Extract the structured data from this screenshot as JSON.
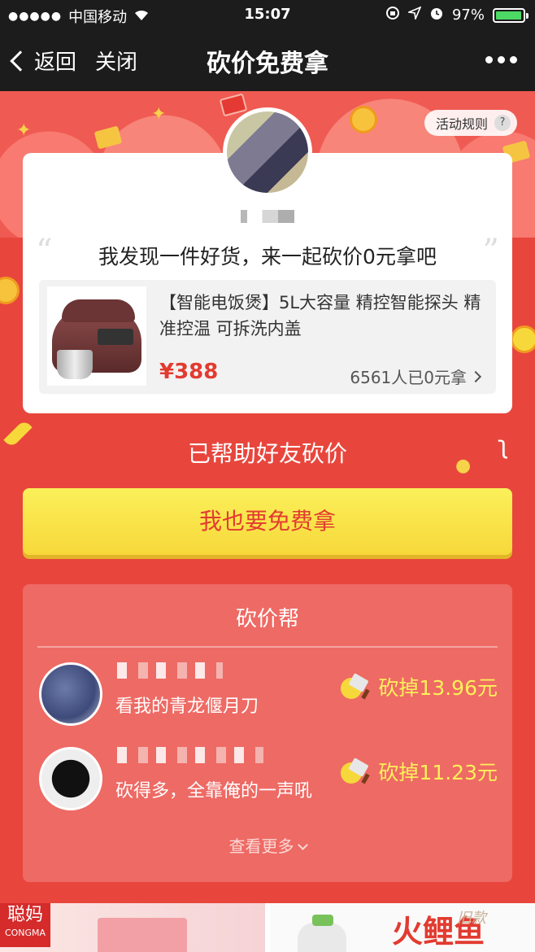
{
  "status_bar": {
    "signal": "●●●●●",
    "carrier": "中国移动",
    "time": "15:07",
    "battery_percent": "97%",
    "battery_level": 0.97
  },
  "nav": {
    "back_label": "返回",
    "close_label": "关闭",
    "title": "砍价免费拿"
  },
  "rules_button": {
    "label": "活动规则",
    "icon_glyph": "?"
  },
  "share_card": {
    "quote_open": "“",
    "quote": "我发现一件好货，来一起砍价0元拿吧",
    "quote_close": "”",
    "product": {
      "title": "【智能电饭煲】5L大容量 精控智能探头 精准控温 可拆洗内盖",
      "price": "¥388",
      "claimed": "6561人已0元拿"
    }
  },
  "helped_text": "已帮助好友砍价",
  "free_button_label": "我也要免费拿",
  "help_group": {
    "title": "砍价帮",
    "helpers": [
      {
        "message": "看我的青龙偃月刀",
        "cut": "砍掉13.96元"
      },
      {
        "message": "砍得多，全靠俺的一声吼",
        "cut": "砍掉11.23元"
      }
    ],
    "more_label": "查看更多"
  },
  "ads": {
    "brand1_big": "聪妈",
    "brand1_small": "CONGMA",
    "watermark": "火鲤鱼",
    "ad2_tag": "旧款"
  },
  "colors": {
    "page_red": "#e8463d",
    "price_red": "#e23b30",
    "button_yellow": "#f7d83a",
    "cut_yellow": "#fbf05a",
    "battery_green": "#4cd964"
  }
}
